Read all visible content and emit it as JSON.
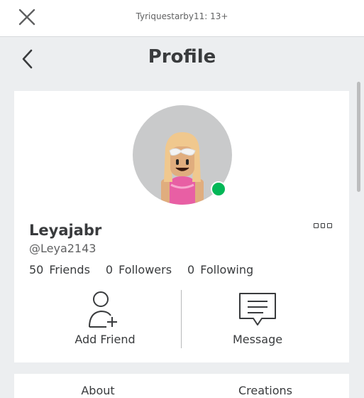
{
  "topbar": {
    "user_age": "Tyriquestarby11: 13+"
  },
  "header": {
    "title": "Profile"
  },
  "profile": {
    "display_name": "Leyajabr",
    "username": "@Leya2143",
    "online_status_color": "#02b757",
    "stats": [
      {
        "count": "50",
        "label": "Friends"
      },
      {
        "count": "0",
        "label": "Followers"
      },
      {
        "count": "0",
        "label": "Following"
      }
    ],
    "actions": {
      "add_friend_label": "Add Friend",
      "message_label": "Message"
    }
  },
  "tabs": [
    {
      "label": "About"
    },
    {
      "label": "Creations"
    }
  ],
  "icons": [
    "close-icon",
    "back-chevron-icon",
    "more-options-icon",
    "add-friend-icon",
    "message-icon"
  ]
}
